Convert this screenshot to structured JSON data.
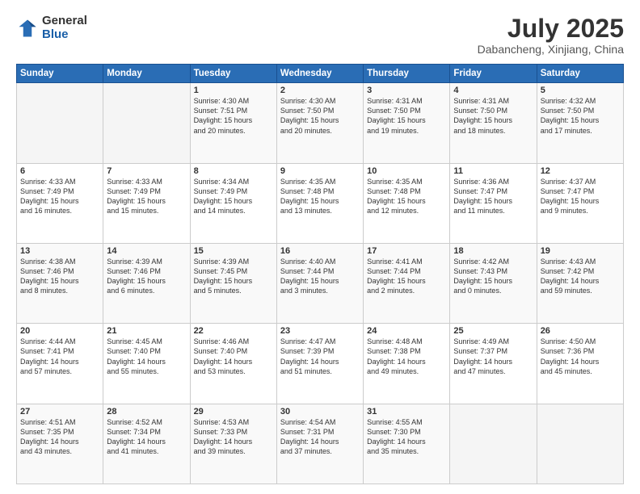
{
  "header": {
    "logo": {
      "general": "General",
      "blue": "Blue"
    },
    "title": "July 2025",
    "subtitle": "Dabancheng, Xinjiang, China"
  },
  "calendar": {
    "days_of_week": [
      "Sunday",
      "Monday",
      "Tuesday",
      "Wednesday",
      "Thursday",
      "Friday",
      "Saturday"
    ],
    "weeks": [
      [
        {
          "day": "",
          "info": ""
        },
        {
          "day": "",
          "info": ""
        },
        {
          "day": "1",
          "info": "Sunrise: 4:30 AM\nSunset: 7:51 PM\nDaylight: 15 hours\nand 20 minutes."
        },
        {
          "day": "2",
          "info": "Sunrise: 4:30 AM\nSunset: 7:50 PM\nDaylight: 15 hours\nand 20 minutes."
        },
        {
          "day": "3",
          "info": "Sunrise: 4:31 AM\nSunset: 7:50 PM\nDaylight: 15 hours\nand 19 minutes."
        },
        {
          "day": "4",
          "info": "Sunrise: 4:31 AM\nSunset: 7:50 PM\nDaylight: 15 hours\nand 18 minutes."
        },
        {
          "day": "5",
          "info": "Sunrise: 4:32 AM\nSunset: 7:50 PM\nDaylight: 15 hours\nand 17 minutes."
        }
      ],
      [
        {
          "day": "6",
          "info": "Sunrise: 4:33 AM\nSunset: 7:49 PM\nDaylight: 15 hours\nand 16 minutes."
        },
        {
          "day": "7",
          "info": "Sunrise: 4:33 AM\nSunset: 7:49 PM\nDaylight: 15 hours\nand 15 minutes."
        },
        {
          "day": "8",
          "info": "Sunrise: 4:34 AM\nSunset: 7:49 PM\nDaylight: 15 hours\nand 14 minutes."
        },
        {
          "day": "9",
          "info": "Sunrise: 4:35 AM\nSunset: 7:48 PM\nDaylight: 15 hours\nand 13 minutes."
        },
        {
          "day": "10",
          "info": "Sunrise: 4:35 AM\nSunset: 7:48 PM\nDaylight: 15 hours\nand 12 minutes."
        },
        {
          "day": "11",
          "info": "Sunrise: 4:36 AM\nSunset: 7:47 PM\nDaylight: 15 hours\nand 11 minutes."
        },
        {
          "day": "12",
          "info": "Sunrise: 4:37 AM\nSunset: 7:47 PM\nDaylight: 15 hours\nand 9 minutes."
        }
      ],
      [
        {
          "day": "13",
          "info": "Sunrise: 4:38 AM\nSunset: 7:46 PM\nDaylight: 15 hours\nand 8 minutes."
        },
        {
          "day": "14",
          "info": "Sunrise: 4:39 AM\nSunset: 7:46 PM\nDaylight: 15 hours\nand 6 minutes."
        },
        {
          "day": "15",
          "info": "Sunrise: 4:39 AM\nSunset: 7:45 PM\nDaylight: 15 hours\nand 5 minutes."
        },
        {
          "day": "16",
          "info": "Sunrise: 4:40 AM\nSunset: 7:44 PM\nDaylight: 15 hours\nand 3 minutes."
        },
        {
          "day": "17",
          "info": "Sunrise: 4:41 AM\nSunset: 7:44 PM\nDaylight: 15 hours\nand 2 minutes."
        },
        {
          "day": "18",
          "info": "Sunrise: 4:42 AM\nSunset: 7:43 PM\nDaylight: 15 hours\nand 0 minutes."
        },
        {
          "day": "19",
          "info": "Sunrise: 4:43 AM\nSunset: 7:42 PM\nDaylight: 14 hours\nand 59 minutes."
        }
      ],
      [
        {
          "day": "20",
          "info": "Sunrise: 4:44 AM\nSunset: 7:41 PM\nDaylight: 14 hours\nand 57 minutes."
        },
        {
          "day": "21",
          "info": "Sunrise: 4:45 AM\nSunset: 7:40 PM\nDaylight: 14 hours\nand 55 minutes."
        },
        {
          "day": "22",
          "info": "Sunrise: 4:46 AM\nSunset: 7:40 PM\nDaylight: 14 hours\nand 53 minutes."
        },
        {
          "day": "23",
          "info": "Sunrise: 4:47 AM\nSunset: 7:39 PM\nDaylight: 14 hours\nand 51 minutes."
        },
        {
          "day": "24",
          "info": "Sunrise: 4:48 AM\nSunset: 7:38 PM\nDaylight: 14 hours\nand 49 minutes."
        },
        {
          "day": "25",
          "info": "Sunrise: 4:49 AM\nSunset: 7:37 PM\nDaylight: 14 hours\nand 47 minutes."
        },
        {
          "day": "26",
          "info": "Sunrise: 4:50 AM\nSunset: 7:36 PM\nDaylight: 14 hours\nand 45 minutes."
        }
      ],
      [
        {
          "day": "27",
          "info": "Sunrise: 4:51 AM\nSunset: 7:35 PM\nDaylight: 14 hours\nand 43 minutes."
        },
        {
          "day": "28",
          "info": "Sunrise: 4:52 AM\nSunset: 7:34 PM\nDaylight: 14 hours\nand 41 minutes."
        },
        {
          "day": "29",
          "info": "Sunrise: 4:53 AM\nSunset: 7:33 PM\nDaylight: 14 hours\nand 39 minutes."
        },
        {
          "day": "30",
          "info": "Sunrise: 4:54 AM\nSunset: 7:31 PM\nDaylight: 14 hours\nand 37 minutes."
        },
        {
          "day": "31",
          "info": "Sunrise: 4:55 AM\nSunset: 7:30 PM\nDaylight: 14 hours\nand 35 minutes."
        },
        {
          "day": "",
          "info": ""
        },
        {
          "day": "",
          "info": ""
        }
      ]
    ]
  }
}
